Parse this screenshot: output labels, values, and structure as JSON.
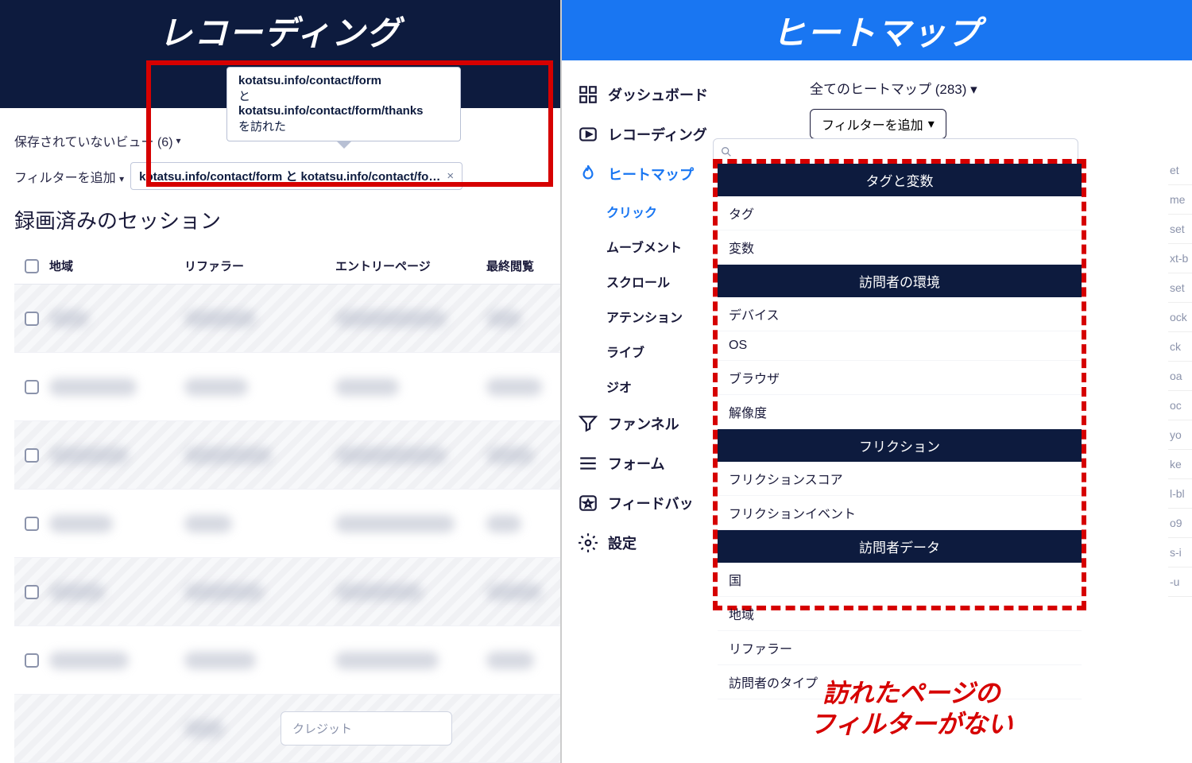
{
  "left": {
    "title": "レコーディング",
    "tooltip": {
      "line1": "kotatsu.info/contact/form",
      "conj": "と",
      "line2": "kotatsu.info/contact/form/thanks",
      "suffix": "を訪れた"
    },
    "unsaved_view": "保存されていないビュー (6)",
    "add_filter": "フィルターを追加",
    "chip_text": "kotatsu.info/contact/form と kotatsu.info/contact/fo…",
    "chip_close": "×",
    "section_heading": "録画済みのセッション",
    "columns": {
      "region": "地域",
      "referrer": "リファラー",
      "entry": "エントリーページ",
      "last": "最終閲覧"
    }
  },
  "right": {
    "title": "ヒートマップ",
    "dropdown_all": "全てのヒートマップ (283)",
    "add_filter": "フィルターを追加",
    "nav": {
      "dashboard": "ダッシュボード",
      "recording": "レコーディング",
      "heatmap": "ヒートマップ",
      "funnel": "ファンネル",
      "form": "フォーム",
      "feedback": "フィードバッ",
      "settings": "設定"
    },
    "heatmap_tabs": {
      "click": "クリック",
      "movement": "ムーブメント",
      "scroll": "スクロール",
      "attention": "アテンション",
      "live": "ライブ",
      "geo": "ジオ"
    },
    "filter_cats": {
      "tags_vars": "タグと変数",
      "tags": "タグ",
      "vars": "変数",
      "env": "訪問者の環境",
      "device": "デバイス",
      "os": "OS",
      "browser": "ブラウザ",
      "resolution": "解像度",
      "friction": "フリクション",
      "fscore": "フリクションスコア",
      "fevent": "フリクションイベント",
      "visitor_data": "訪問者データ",
      "country": "国",
      "region": "地域",
      "referrer": "リファラー",
      "vtype": "訪問者のタイプ"
    },
    "annotation": "訪れたページの\nフィルターがない",
    "credit_placeholder": "クレジット"
  }
}
